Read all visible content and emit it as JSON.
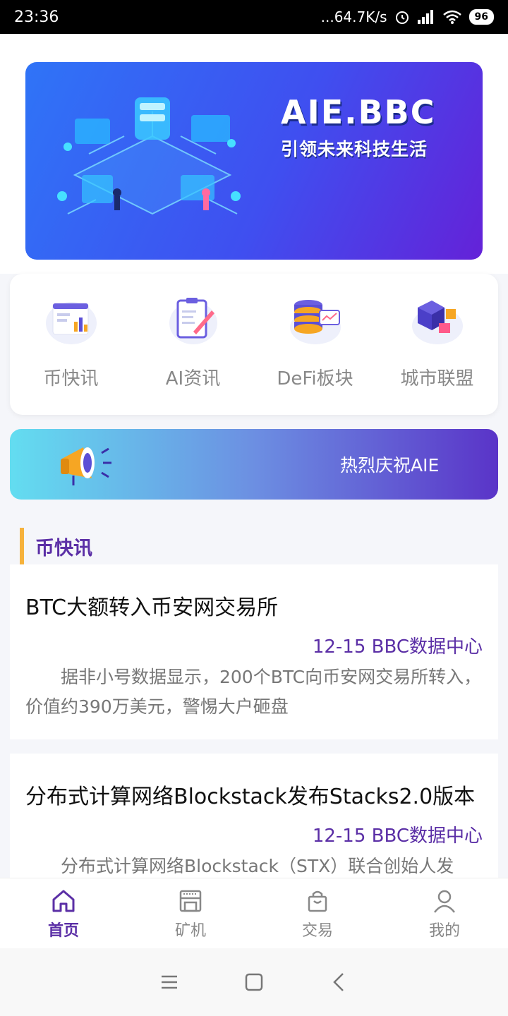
{
  "status_bar": {
    "time": "23:36",
    "network_speed": "...64.7K/s",
    "battery": "96",
    "icons": [
      "alarm-icon",
      "signal-icon",
      "wifi-icon",
      "battery-icon"
    ]
  },
  "banner": {
    "title": "AIE.BBC",
    "subtitle": "引领未来科技生活"
  },
  "quick_menu": {
    "items": [
      {
        "label": "币快讯",
        "icon": "news-chart-icon"
      },
      {
        "label": "AI资讯",
        "icon": "clipboard-pen-icon"
      },
      {
        "label": "DeFi板块",
        "icon": "database-chart-icon"
      },
      {
        "label": "城市联盟",
        "icon": "cubes-icon"
      }
    ]
  },
  "notice": {
    "text": "热烈庆祝AIE",
    "icon": "megaphone-icon"
  },
  "section": {
    "title": "币快讯"
  },
  "news": [
    {
      "title": "BTC大额转入币安网交易所",
      "meta": "12-15 BBC数据中心",
      "body": "据非小号数据显示，200个BTC向币安网交易所转入，价值约390万美元，警惕大户砸盘"
    },
    {
      "title": "分布式计算网络Blockstack发布Stacks2.0版本",
      "meta": "12-15 BBC数据中心",
      "body": "分布式计算网络Blockstack（STX）联合创始人发"
    }
  ],
  "tabbar": {
    "tabs": [
      {
        "label": "首页",
        "icon": "home-icon",
        "active": true
      },
      {
        "label": "矿机",
        "icon": "miner-icon",
        "active": false
      },
      {
        "label": "交易",
        "icon": "shopping-bag-icon",
        "active": false
      },
      {
        "label": "我的",
        "icon": "user-icon",
        "active": false
      }
    ]
  },
  "colors": {
    "accent": "#5b2fa6",
    "section_marker": "#f6b23c",
    "banner_start": "#2f74f7",
    "banner_end": "#6422d8"
  }
}
